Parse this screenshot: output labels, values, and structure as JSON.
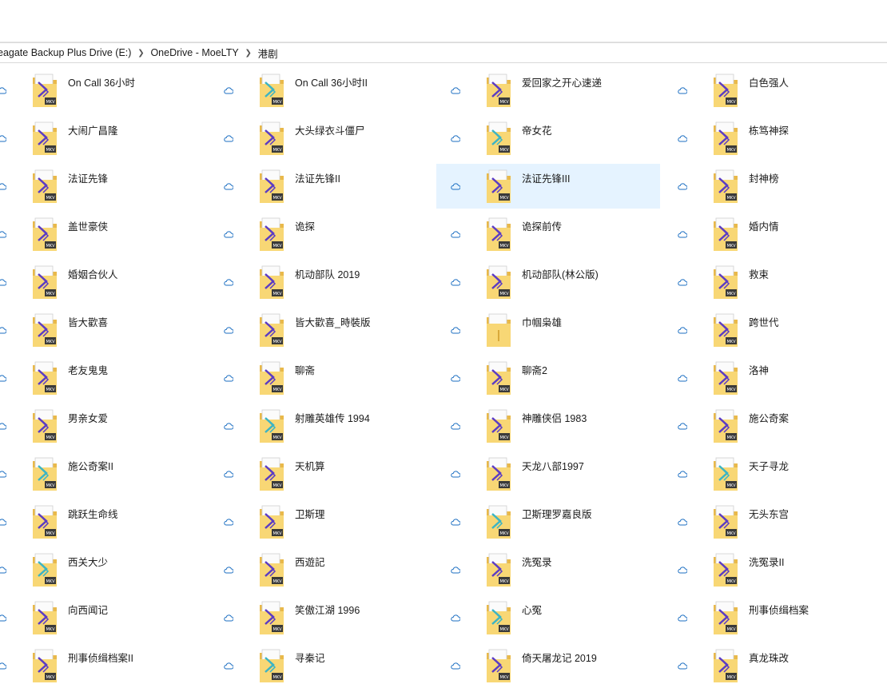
{
  "breadcrumb": [
    "eagate Backup Plus Drive (E:)",
    "OneDrive - MoeLTY",
    "港剧"
  ],
  "folders": [
    [
      "On Call 36小时",
      "On Call 36小时II",
      "爱回家之开心速递",
      "白色强人"
    ],
    [
      "大闹广昌隆",
      "大头绿衣斗僵尸",
      "帝女花",
      "栋笃神探"
    ],
    [
      "法证先锋",
      "法证先锋II",
      "法证先锋III",
      "封神榜"
    ],
    [
      "盖世豪侠",
      "诡探",
      "诡探前传",
      "婚内情"
    ],
    [
      "婚姻合伙人",
      "机动部队 2019",
      "机动部队(林公版)",
      "救束"
    ],
    [
      "皆大歡喜",
      "皆大歡喜_時裝版",
      "巾帼枭雄",
      "跨世代"
    ],
    [
      "老友鬼鬼",
      "聊斋",
      "聊斋2",
      "洛神"
    ],
    [
      "男亲女爱",
      "射雕英雄传 1994",
      "神雕侠侣 1983",
      "施公奇案"
    ],
    [
      "施公奇案II",
      "天机算",
      "天龙八部1997",
      "天子寻龙"
    ],
    [
      "跳跃生命线",
      "卫斯理",
      "卫斯理罗嘉良版",
      "无头东宫"
    ],
    [
      "西关大少",
      "西遊記",
      "洗冤录",
      "洗冤录II"
    ],
    [
      "向西闻记",
      "笑傲江湖 1996",
      "心冤",
      "刑事侦缉档案"
    ],
    [
      "刑事侦缉档案II",
      "寻秦记",
      "倚天屠龙记 2019",
      "真龙珠改"
    ]
  ],
  "selected": "法证先锋III",
  "plain_folder": "巾帼枭雄",
  "teal_folders": [
    "On Call 36小时II",
    "帝女花",
    "施公奇案II",
    "射雕英雄传 1994",
    "天子寻龙",
    "卫斯理罗嘉良版",
    "西关大少",
    "心冤",
    "寻秦记"
  ],
  "icons": {
    "status": "cloud-icon",
    "folder": "folder-mkv-icon"
  },
  "colors": {
    "selection": "#e5f3ff",
    "folder": "#f8d775",
    "kodi_purple": "#5b3cc4",
    "kodi_teal": "#3cb4c4",
    "cloud": "#1b6ec2"
  }
}
